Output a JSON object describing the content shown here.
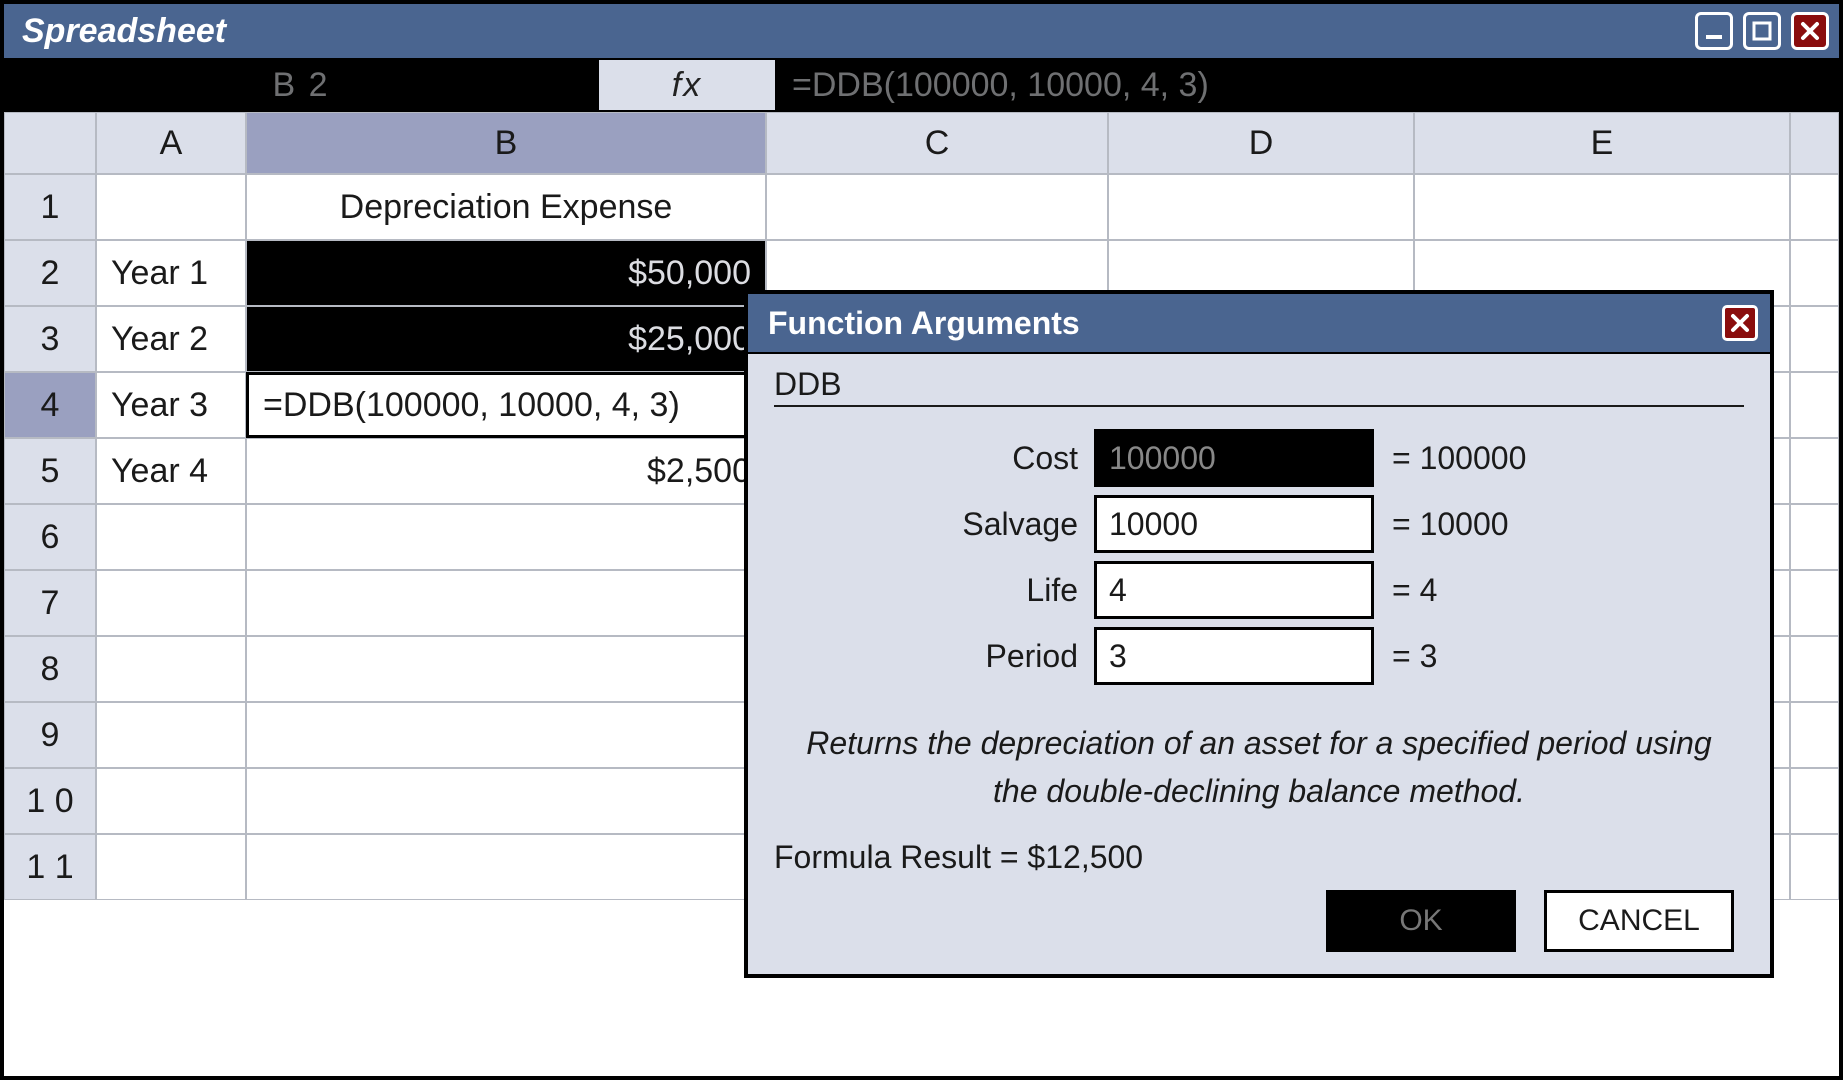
{
  "window": {
    "title": "Spreadsheet"
  },
  "formulaBar": {
    "cellRef": "B 2",
    "fxLabel": "fx",
    "formula": "=DDB(100000, 10000, 4, 3)"
  },
  "columns": [
    "A",
    "B",
    "C",
    "D",
    "E"
  ],
  "selectedColumn": "B",
  "activeRow": 4,
  "rows": [
    {
      "n": "1",
      "A": "",
      "B": "Depreciation Expense",
      "B_align": "center"
    },
    {
      "n": "2",
      "A": "Year 1",
      "B": "$50,000",
      "B_black": true,
      "B_align": "right"
    },
    {
      "n": "3",
      "A": "Year 2",
      "B": "$25,000",
      "B_black": true,
      "B_align": "right"
    },
    {
      "n": "4",
      "A": "Year 3",
      "B": "=DDB(100000, 10000, 4, 3)",
      "B_align": "left",
      "active": true
    },
    {
      "n": "5",
      "A": "Year 4",
      "B": "$2,500",
      "B_align": "right"
    },
    {
      "n": "6",
      "A": "",
      "B": ""
    },
    {
      "n": "7",
      "A": "",
      "B": ""
    },
    {
      "n": "8",
      "A": "",
      "B": ""
    },
    {
      "n": "9",
      "A": "",
      "B": ""
    },
    {
      "n": "1 0",
      "A": "",
      "B": ""
    },
    {
      "n": "1 1",
      "A": "",
      "B": ""
    }
  ],
  "dialog": {
    "title": "Function Arguments",
    "functionName": "DDB",
    "args": [
      {
        "label": "Cost",
        "value": "100000",
        "result": "= 100000",
        "active": true
      },
      {
        "label": "Salvage",
        "value": "10000",
        "result": "= 10000"
      },
      {
        "label": "Life",
        "value": "4",
        "result": "= 4"
      },
      {
        "label": "Period",
        "value": "3",
        "result": "= 3"
      }
    ],
    "description": "Returns the depreciation of an asset for a specified period using the double-declining balance method.",
    "formulaResultLabel": "Formula Result = ",
    "formulaResultValue": "$12,500",
    "okLabel": "OK",
    "cancelLabel": "CANCEL"
  }
}
